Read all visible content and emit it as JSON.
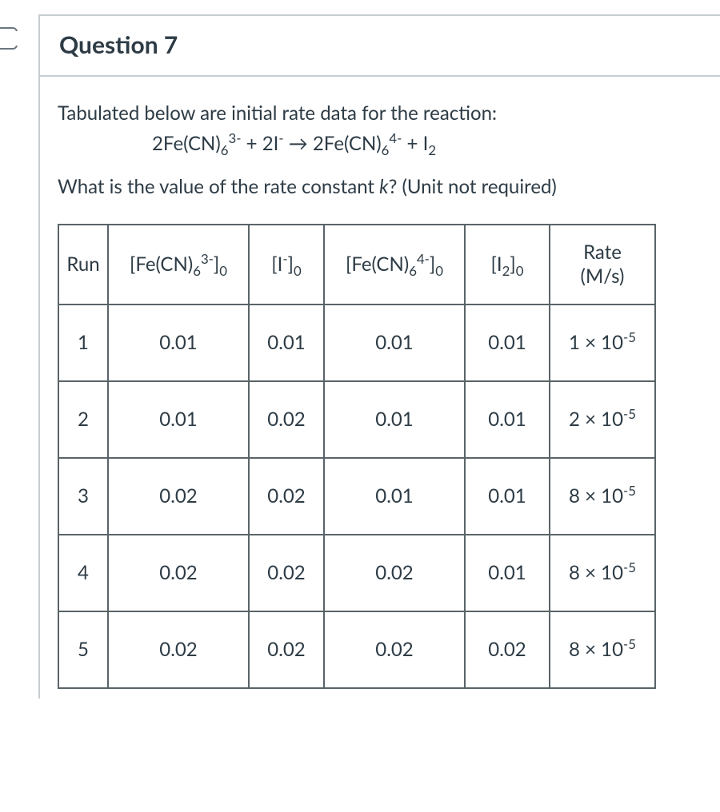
{
  "question": {
    "title": "Question 7",
    "intro": "Tabulated below are initial rate data for the reaction:",
    "equation_html": "2Fe(CN)<sub>6</sub><sup>3-</sup> + 2I<sup>-</sup> → 2Fe(CN)<sub>6</sub><sup>4-</sup> + I<sub>2</sub>",
    "followup_pre": "What is the value of the rate constant ",
    "followup_var": "k",
    "followup_post": "? (Unit not required)"
  },
  "table": {
    "headers": {
      "run": "Run",
      "fe3_html": "[Fe(CN)<sub>6</sub><sup>3-</sup>]<sub>0</sub>",
      "i_html": "[I<sup>-</sup>]<sub>0</sub>",
      "fe4_html": "[Fe(CN)<sub>6</sub><sup>4-</sup>]<sub>0</sub>",
      "i2_html": "[I<sub>2</sub>]<sub>0</sub>",
      "rate_line1": "Rate",
      "rate_line2": "(M/s)"
    },
    "rows": [
      {
        "run": "1",
        "fe3": "0.01",
        "i": "0.01",
        "fe4": "0.01",
        "i2": "0.01",
        "rate_html": "1 × 10<sup>-5</sup>"
      },
      {
        "run": "2",
        "fe3": "0.01",
        "i": "0.02",
        "fe4": "0.01",
        "i2": "0.01",
        "rate_html": "2 × 10<sup>-5</sup>"
      },
      {
        "run": "3",
        "fe3": "0.02",
        "i": "0.02",
        "fe4": "0.01",
        "i2": "0.01",
        "rate_html": "8 × 10<sup>-5</sup>"
      },
      {
        "run": "4",
        "fe3": "0.02",
        "i": "0.02",
        "fe4": "0.02",
        "i2": "0.01",
        "rate_html": "8 × 10<sup>-5</sup>"
      },
      {
        "run": "5",
        "fe3": "0.02",
        "i": "0.02",
        "fe4": "0.02",
        "i2": "0.02",
        "rate_html": "8 × 10<sup>-5</sup>"
      }
    ]
  },
  "chart_data": {
    "type": "table",
    "title": "Initial rate data for 2Fe(CN)6^3- + 2I- → 2Fe(CN)6^4- + I2",
    "columns": [
      "Run",
      "[Fe(CN)6^3-]0",
      "[I-]0",
      "[Fe(CN)6^4-]0",
      "[I2]0",
      "Rate (M/s)"
    ],
    "rows": [
      [
        1,
        0.01,
        0.01,
        0.01,
        0.01,
        1e-05
      ],
      [
        2,
        0.01,
        0.02,
        0.01,
        0.01,
        2e-05
      ],
      [
        3,
        0.02,
        0.02,
        0.01,
        0.01,
        8e-05
      ],
      [
        4,
        0.02,
        0.02,
        0.02,
        0.01,
        8e-05
      ],
      [
        5,
        0.02,
        0.02,
        0.02,
        0.02,
        8e-05
      ]
    ]
  }
}
